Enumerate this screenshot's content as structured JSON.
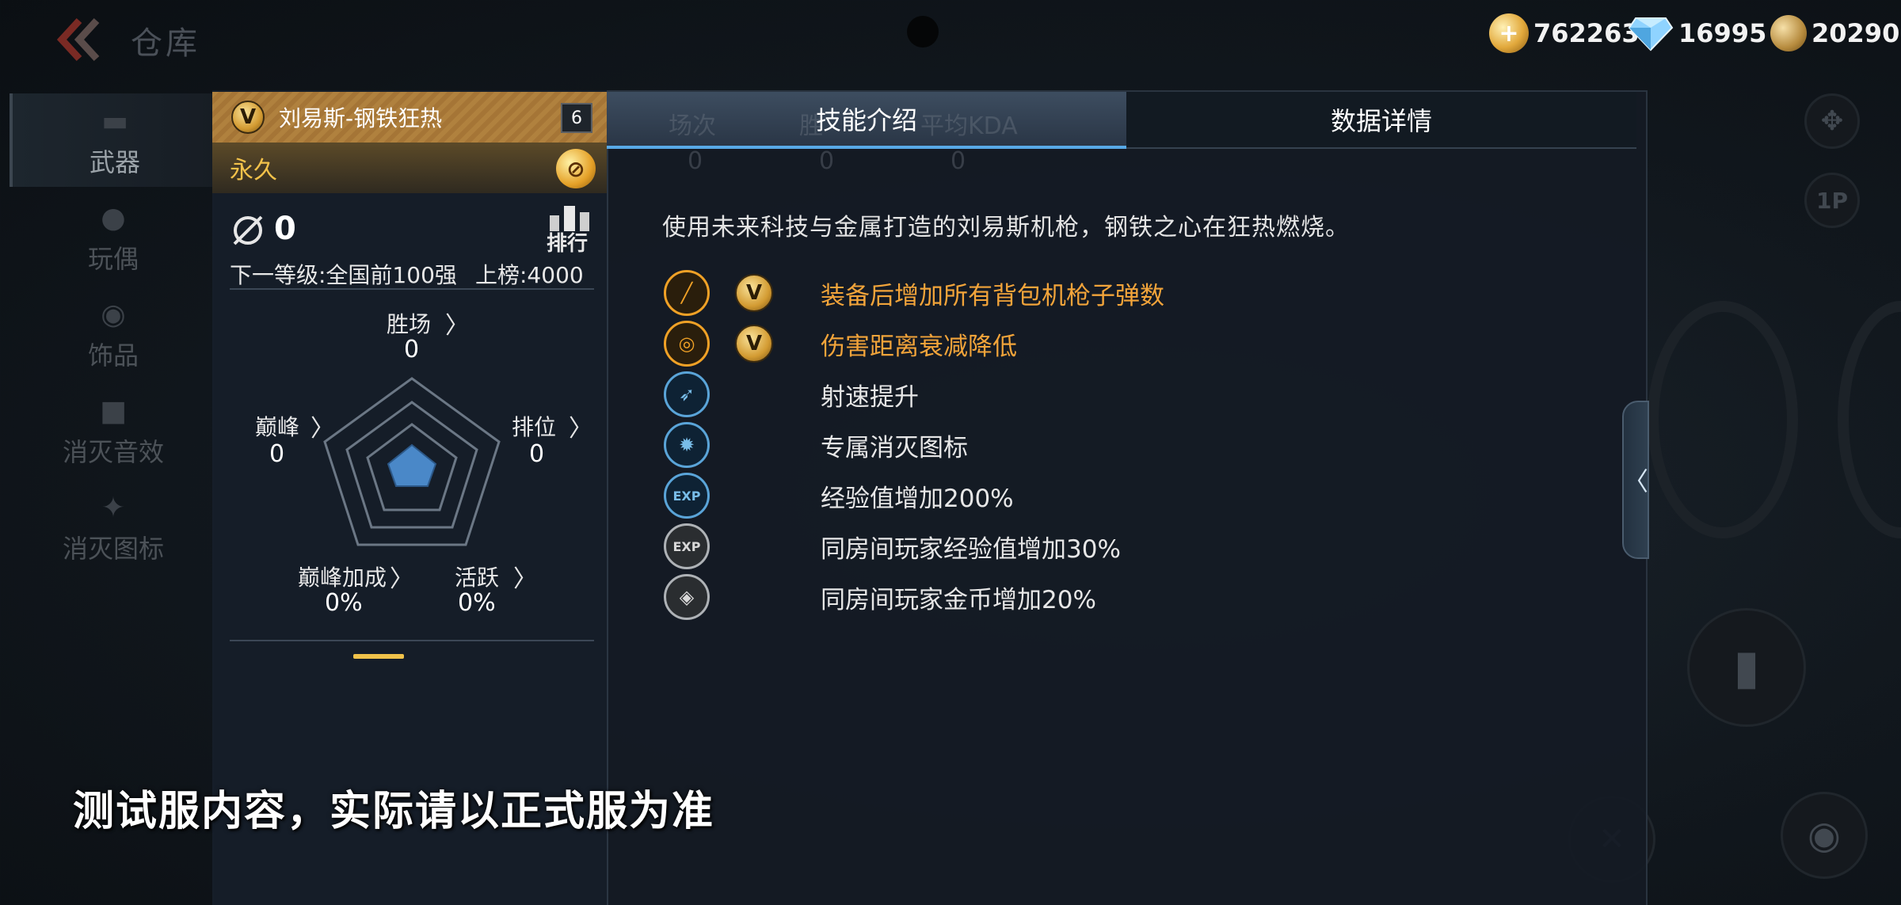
{
  "header": {
    "title": "仓库",
    "currencies": [
      {
        "name": "gold",
        "value": "762263"
      },
      {
        "name": "diamond",
        "value": "16995"
      },
      {
        "name": "medal",
        "value": "20290"
      }
    ]
  },
  "left_nav": {
    "items": [
      {
        "label": "武器",
        "icon": "rifle-icon",
        "active": true
      },
      {
        "label": "玩偶",
        "icon": "doll-icon",
        "active": false
      },
      {
        "label": "饰品",
        "icon": "accessory-icon",
        "active": false
      },
      {
        "label": "消灭音效",
        "icon": "sound-icon",
        "active": false
      },
      {
        "label": "消灭图标",
        "icon": "emblem-icon",
        "active": false
      }
    ]
  },
  "card": {
    "badge": "V",
    "name": "刘易斯-钢铁狂热",
    "level": "6",
    "duration": "永久",
    "kills": "0",
    "rank_label": "排行",
    "next_level": "下一等级:全国前100强",
    "rank_requirement": "上榜:4000",
    "stats": {
      "wins": {
        "label": "胜场",
        "value": "0"
      },
      "ranked": {
        "label": "排位",
        "value": "0"
      },
      "peak": {
        "label": "巅峰",
        "value": "0"
      },
      "peak_bonus": {
        "label": "巅峰加成",
        "value": "0%"
      },
      "active": {
        "label": "活跃",
        "value": "0%"
      }
    }
  },
  "tabs": {
    "skill": "技能介绍",
    "data": "数据详情",
    "ghost_headers": [
      "场次",
      "胜",
      "平均KDA"
    ],
    "ghost_values": [
      "0",
      "0",
      "0"
    ]
  },
  "skills": {
    "description": "使用未来科技与金属打造的刘易斯机枪，钢铁之心在狂热燃烧。",
    "items": [
      {
        "text": "装备后增加所有背包机枪子弹数",
        "style": "gold",
        "icon": "ammo-icon",
        "has_v": true
      },
      {
        "text": "伤害距离衰减降低",
        "style": "gold",
        "icon": "range-icon",
        "has_v": true
      },
      {
        "text": "射速提升",
        "style": "blue",
        "icon": "firerate-icon",
        "has_v": false
      },
      {
        "text": "专属消灭图标",
        "style": "blue",
        "icon": "kill-emblem-icon",
        "has_v": false
      },
      {
        "text": "经验值增加200%",
        "style": "blue",
        "icon": "exp-icon",
        "has_v": false
      },
      {
        "text": "同房间玩家经验值增加30%",
        "style": "grey",
        "icon": "room-exp-icon",
        "has_v": false
      },
      {
        "text": "同房间玩家金币增加20%",
        "style": "grey",
        "icon": "room-gold-icon",
        "has_v": false
      }
    ]
  },
  "right_controls": {
    "one_p": "1P"
  },
  "notice": "测试服内容，实际请以正式服为准",
  "colors": {
    "accent_gold": "#f2a43a",
    "accent_blue": "#58a9e6",
    "card_header": "#b0813e"
  }
}
